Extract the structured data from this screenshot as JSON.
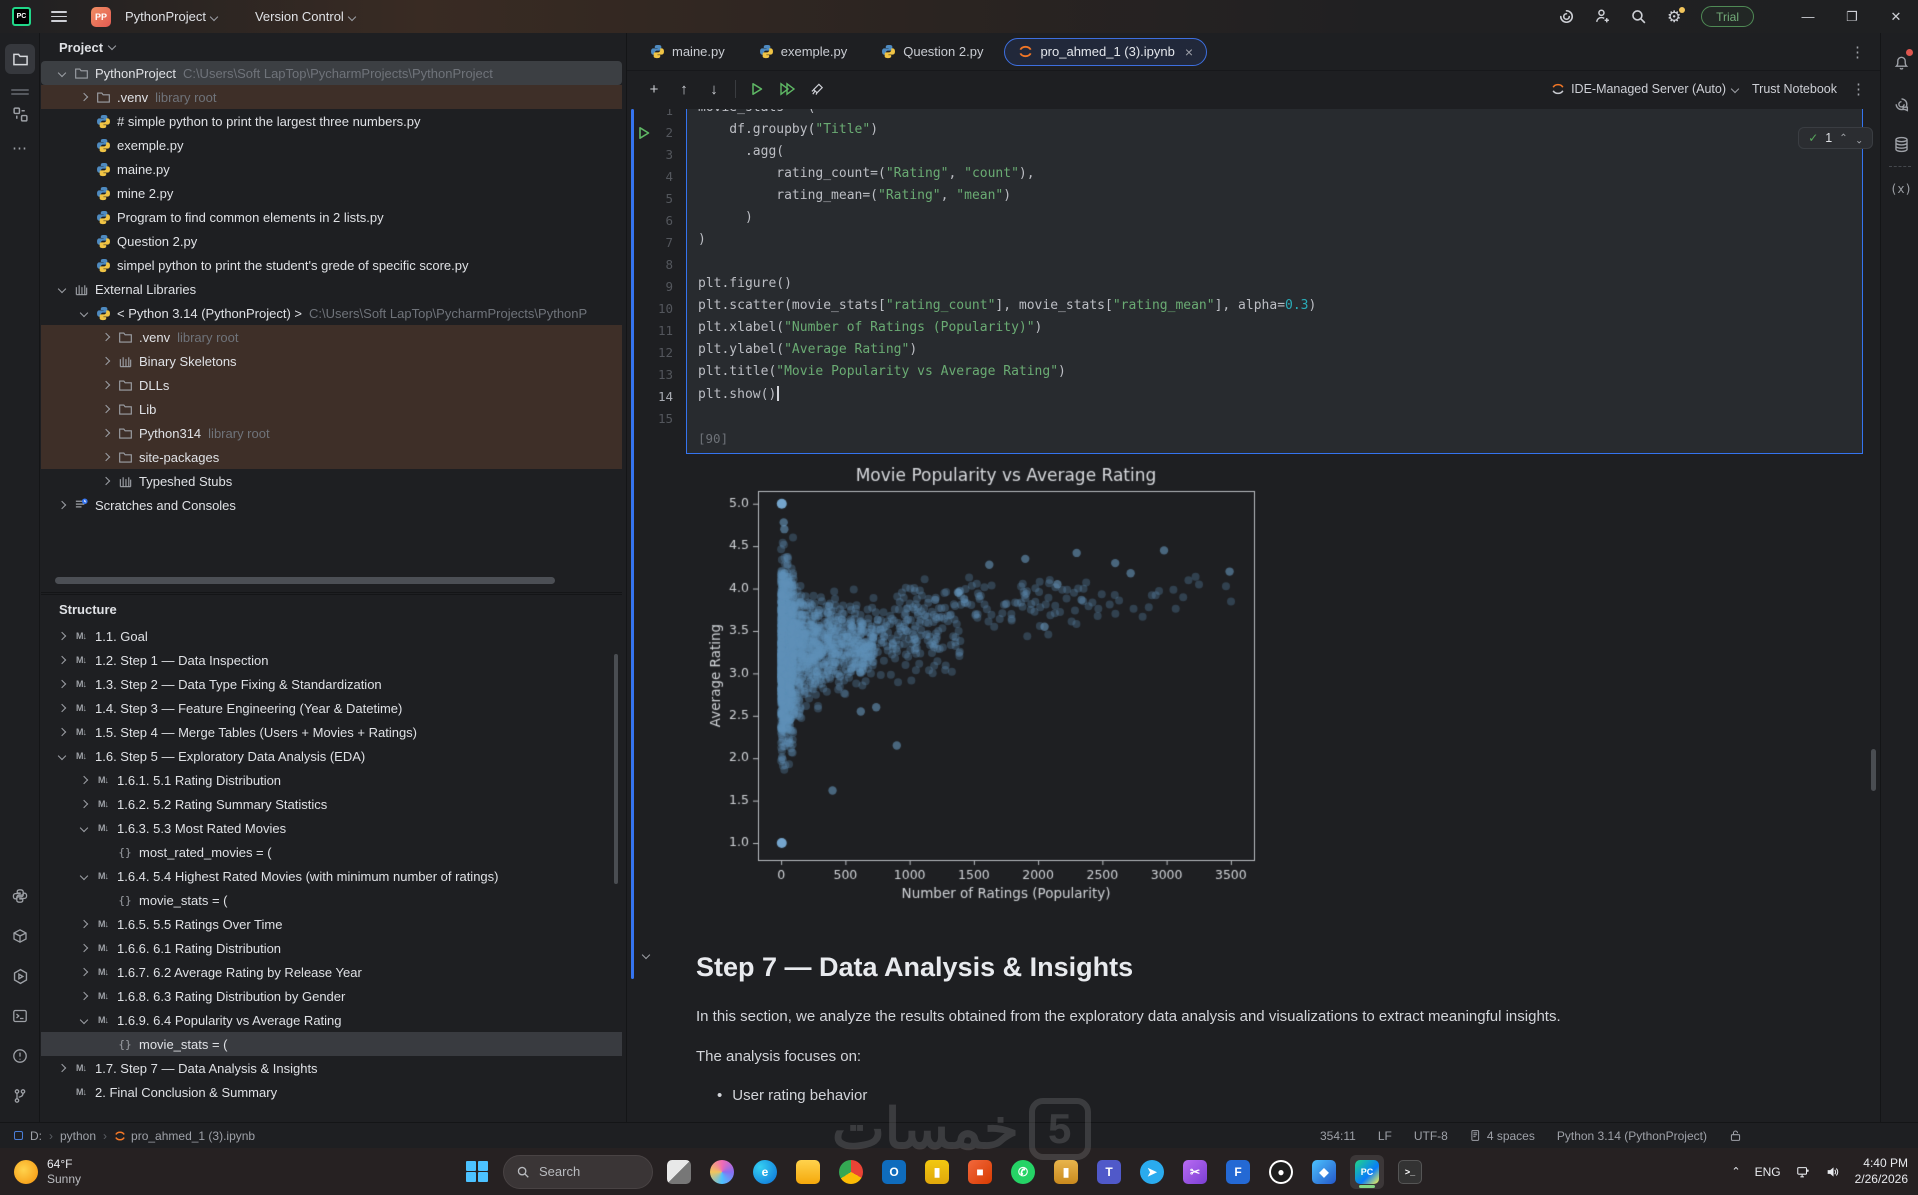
{
  "titlebar": {
    "app": "PC",
    "project_menu": "PythonProject",
    "vcs_menu": "Version Control",
    "trial_badge": "Trial"
  },
  "left_panel": {
    "project_header": "Project",
    "tree": [
      {
        "label": "PythonProject",
        "suffix": "C:\\Users\\Soft LapTop\\PycharmProjects\\PythonProject",
        "depth": 0,
        "icon": "folder",
        "chev": "down",
        "bg": "selg"
      },
      {
        "label": ".venv",
        "suffix": "library root",
        "depth": 1,
        "icon": "folder",
        "chev": "right",
        "bg": "brown"
      },
      {
        "label": "# simple python to print the largest three numbers.py",
        "depth": 1,
        "icon": "python"
      },
      {
        "label": "exemple.py",
        "depth": 1,
        "icon": "python"
      },
      {
        "label": "maine.py",
        "depth": 1,
        "icon": "python"
      },
      {
        "label": "mine 2.py",
        "depth": 1,
        "icon": "python"
      },
      {
        "label": "Program to find common elements in 2 lists.py",
        "depth": 1,
        "icon": "python"
      },
      {
        "label": "Question 2.py",
        "depth": 1,
        "icon": "python"
      },
      {
        "label": "simpel python to print the student's grede of specific score.py",
        "depth": 1,
        "icon": "python"
      },
      {
        "label": "External Libraries",
        "depth": 0,
        "icon": "lib",
        "chev": "down"
      },
      {
        "label": "< Python 3.14 (PythonProject) >",
        "suffix": "C:\\Users\\Soft LapTop\\PycharmProjects\\PythonP",
        "depth": 1,
        "icon": "python",
        "chev": "down"
      },
      {
        "label": ".venv",
        "suffix": "library root",
        "depth": 2,
        "icon": "folder",
        "chev": "right",
        "bg": "brown"
      },
      {
        "label": "Binary Skeletons",
        "depth": 2,
        "icon": "lib",
        "chev": "right",
        "bg": "brown"
      },
      {
        "label": "DLLs",
        "depth": 2,
        "icon": "folder",
        "chev": "right",
        "bg": "brown"
      },
      {
        "label": "Lib",
        "depth": 2,
        "icon": "folder",
        "chev": "right",
        "bg": "brown"
      },
      {
        "label": "Python314",
        "suffix": "library root",
        "depth": 2,
        "icon": "folder",
        "chev": "right",
        "bg": "brown"
      },
      {
        "label": "site-packages",
        "depth": 2,
        "icon": "folder",
        "chev": "right",
        "bg": "brown"
      },
      {
        "label": "Typeshed Stubs",
        "depth": 2,
        "icon": "lib",
        "chev": "right"
      },
      {
        "label": "Scratches and Consoles",
        "depth": 0,
        "icon": "scratch",
        "chev": "right"
      }
    ],
    "structure_header": "Structure",
    "structure": [
      {
        "label": "1.1. Goal",
        "depth": 0,
        "icon": "md",
        "chev": "right"
      },
      {
        "label": "1.2. Step 1 — Data Inspection",
        "depth": 0,
        "icon": "md",
        "chev": "right"
      },
      {
        "label": "1.3. Step 2 — Data Type Fixing & Standardization",
        "depth": 0,
        "icon": "md",
        "chev": "right"
      },
      {
        "label": "1.4. Step 3 — Feature Engineering (Year & Datetime)",
        "depth": 0,
        "icon": "md",
        "chev": "right"
      },
      {
        "label": "1.5. Step 4 — Merge Tables (Users + Movies + Ratings)",
        "depth": 0,
        "icon": "md",
        "chev": "right"
      },
      {
        "label": "1.6. Step 5 — Exploratory Data Analysis (EDA)",
        "depth": 0,
        "icon": "md",
        "chev": "down"
      },
      {
        "label": "1.6.1. 5.1 Rating Distribution",
        "depth": 1,
        "icon": "md",
        "chev": "right"
      },
      {
        "label": "1.6.2. 5.2 Rating Summary Statistics",
        "depth": 1,
        "icon": "md",
        "chev": "right"
      },
      {
        "label": "1.6.3. 5.3 Most Rated Movies",
        "depth": 1,
        "icon": "md",
        "chev": "down"
      },
      {
        "label": "most_rated_movies = (",
        "depth": 2,
        "icon": "braces"
      },
      {
        "label": "1.6.4. 5.4 Highest Rated Movies (with minimum number of ratings)",
        "depth": 1,
        "icon": "md",
        "chev": "down"
      },
      {
        "label": "movie_stats = (",
        "depth": 2,
        "icon": "braces"
      },
      {
        "label": "1.6.5. 5.5 Ratings Over Time",
        "depth": 1,
        "icon": "md",
        "chev": "right"
      },
      {
        "label": "1.6.6. 6.1 Rating Distribution",
        "depth": 1,
        "icon": "md",
        "chev": "right"
      },
      {
        "label": "1.6.7. 6.2 Average Rating by Release Year",
        "depth": 1,
        "icon": "md",
        "chev": "right"
      },
      {
        "label": "1.6.8. 6.3 Rating Distribution by Gender",
        "depth": 1,
        "icon": "md",
        "chev": "right"
      },
      {
        "label": "1.6.9. 6.4 Popularity vs Average Rating",
        "depth": 1,
        "icon": "md",
        "chev": "down"
      },
      {
        "label": "movie_stats = (",
        "depth": 2,
        "icon": "braces",
        "bg": "sels"
      },
      {
        "label": "1.7. Step 7 — Data Analysis & Insights",
        "depth": 0,
        "icon": "md",
        "chev": "right"
      },
      {
        "label": "2. Final Conclusion & Summary",
        "depth": 0,
        "icon": "md"
      }
    ]
  },
  "tabs": [
    {
      "label": "maine.py",
      "icon": "python",
      "active": false
    },
    {
      "label": "exemple.py",
      "icon": "python",
      "active": false
    },
    {
      "label": "Question 2.py",
      "icon": "python",
      "active": false
    },
    {
      "label": "pro_ahmed_1 (3).ipynb",
      "icon": "jupyter",
      "active": true,
      "close": "×"
    }
  ],
  "notebook_toolbar": {
    "server_label": "IDE-Managed Server (Auto)",
    "trust_label": "Trust Notebook",
    "exec_count": "1"
  },
  "code_cell": {
    "run_line": 2,
    "lines": [
      "movie_stats = (",
      "    df.groupby(\"Title\")",
      "      .agg(",
      "          rating_count=(\"Rating\", \"count\"),",
      "          rating_mean=(\"Rating\", \"mean\")",
      "      )",
      ")",
      "",
      "plt.figure()",
      "plt.scatter(movie_stats[\"rating_count\"], movie_stats[\"rating_mean\"], alpha=0.3)",
      "plt.xlabel(\"Number of Ratings (Popularity)\")",
      "plt.ylabel(\"Average Rating\")",
      "plt.title(\"Movie Popularity vs Average Rating\")",
      "plt.show()",
      ""
    ],
    "cursor_line": 14,
    "output_label": "[90]"
  },
  "chart_data": {
    "type": "scatter",
    "title": "Movie Popularity vs Average Rating",
    "xlabel": "Number of Ratings (Popularity)",
    "ylabel": "Average Rating",
    "xlim": [
      -180,
      3680
    ],
    "ylim": [
      0.8,
      5.15
    ],
    "xticks": [
      0,
      500,
      1000,
      1500,
      2000,
      2500,
      3000,
      3500
    ],
    "yticks": [
      1.0,
      1.5,
      2.0,
      2.5,
      3.0,
      3.5,
      4.0,
      4.5,
      5.0
    ],
    "marker_color": "#1f77b4",
    "alpha": 0.3,
    "n_points": 2400,
    "seed": 42,
    "distribution": "dense funnel: most movies have few ratings spanning the full 1-5 range; spread narrows toward 3.2-4.4 as rating count grows",
    "notable_points": [
      [
        5,
        5.0
      ],
      [
        5,
        1.0
      ],
      [
        20,
        4.78
      ],
      [
        25,
        4.7
      ],
      [
        3490,
        4.2
      ],
      [
        2980,
        4.45
      ],
      [
        2720,
        4.18
      ],
      [
        2600,
        4.3
      ],
      [
        2300,
        4.42
      ],
      [
        2150,
        4.05
      ],
      [
        2050,
        3.55
      ],
      [
        1900,
        4.35
      ],
      [
        1620,
        4.28
      ],
      [
        1380,
        3.95
      ],
      [
        900,
        2.15
      ],
      [
        740,
        2.6
      ],
      [
        620,
        2.55
      ],
      [
        400,
        1.62
      ]
    ]
  },
  "markdown": {
    "heading": "Step 7 — Data Analysis & Insights",
    "para1": "In this section, we analyze the results obtained from the exploratory data analysis and visualizations to extract meaningful insights.",
    "para2": "The analysis focuses on:",
    "bullets": [
      "User rating behavior"
    ]
  },
  "status_bar": {
    "breadcrumbs": [
      "D:",
      "python",
      "pro_ahmed_1 (3).ipynb"
    ],
    "caret_position": "354:11",
    "line_ending": "LF",
    "encoding": "UTF-8",
    "indent": "4 spaces",
    "interpreter": "Python 3.14 (PythonProject)"
  },
  "taskbar": {
    "temp": "64°F",
    "weather": "Sunny",
    "search_placeholder": "Search",
    "apps": [
      "task-view",
      "copilot",
      "edge",
      "file-explorer",
      "chrome",
      "outlook",
      "powerbi",
      "office",
      "whatsapp",
      "gold-chart",
      "teams",
      "telegram",
      "snipping",
      "flow",
      "obs",
      "paint3d",
      "pycharm",
      "terminal"
    ],
    "active_app": "pycharm",
    "language": "ENG",
    "time": "4:40 PM",
    "date": "2/26/2026"
  },
  "watermark": {
    "text": "خمسات",
    "digit": "5"
  }
}
